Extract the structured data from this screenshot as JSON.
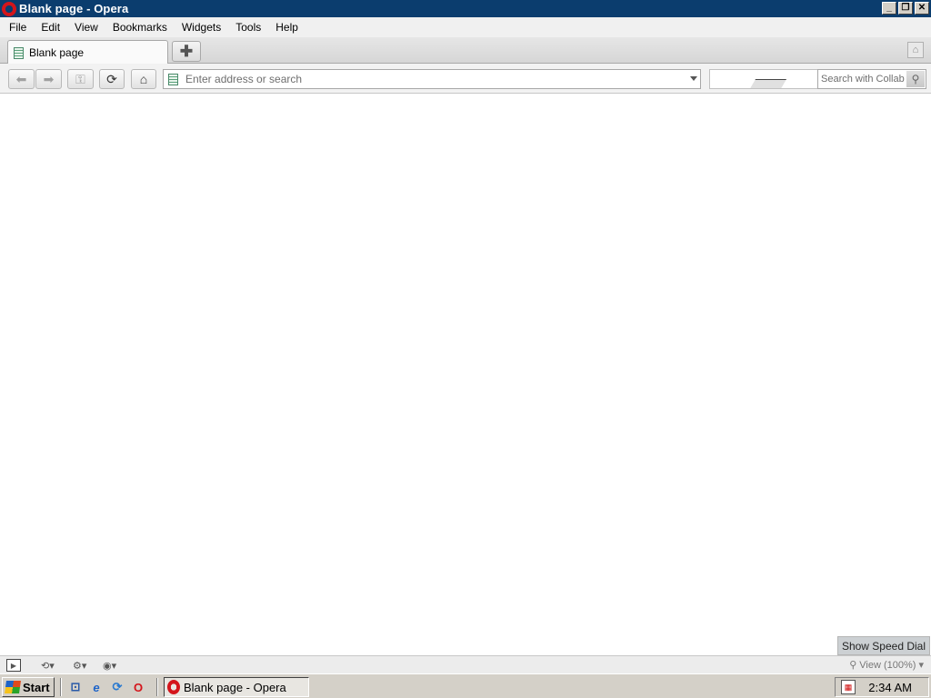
{
  "window": {
    "title": "Blank page - Opera",
    "controls": [
      "minimize",
      "restore",
      "close"
    ]
  },
  "menubar": {
    "items": [
      {
        "label": "File"
      },
      {
        "label": "Edit"
      },
      {
        "label": "View"
      },
      {
        "label": "Bookmarks"
      },
      {
        "label": "Widgets"
      },
      {
        "label": "Tools"
      },
      {
        "label": "Help"
      }
    ]
  },
  "tabs": [
    {
      "label": "Blank page",
      "active": true,
      "icon": "page-icon"
    }
  ],
  "newtab": {
    "icon": "plus-icon"
  },
  "navbar": {
    "address_placeholder": "Enter address or search",
    "address_value": "",
    "search_placeholder": "Search with Collab",
    "buttons": [
      "back-icon",
      "forward-icon",
      "key-icon",
      "reload-icon",
      "home-icon"
    ]
  },
  "content": {
    "speed_dial_label": "Show Speed Dial"
  },
  "statusbar": {
    "zoom_label": "View (100%)"
  },
  "taskbar": {
    "start_label": "Start",
    "task_label": "Blank page - Opera",
    "clock": "2:34 AM"
  },
  "colors": {
    "titlebar": "#0b3d6e",
    "opera_red": "#d4151b",
    "taskbar": "#d4d0c8"
  }
}
